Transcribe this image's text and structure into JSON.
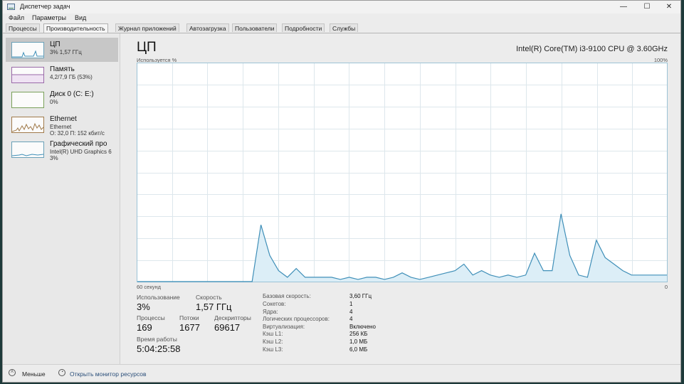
{
  "window": {
    "title": "Диспетчер задач",
    "minimize_glyph": "—",
    "maximize_glyph": "☐",
    "close_glyph": "✕"
  },
  "menu": [
    "Файл",
    "Параметры",
    "Вид"
  ],
  "tabs": [
    "Процессы",
    "Производительность",
    "Журнал приложений",
    "Автозагрузка",
    "Пользователи",
    "Подробности",
    "Службы"
  ],
  "active_tab": 1,
  "sidebar": {
    "items": [
      {
        "name": "ЦП",
        "sub": "3% 1,57 ГГц",
        "sub2": ""
      },
      {
        "name": "Память",
        "sub": "4,2/7,9 ГБ (53%)",
        "sub2": ""
      },
      {
        "name": "Диск 0 (C: E:)",
        "sub": "0%",
        "sub2": ""
      },
      {
        "name": "Ethernet",
        "sub": "Ethernet",
        "sub2": "О: 32,0 П: 152 кбит/с"
      },
      {
        "name": "Графический про",
        "sub": "Intel(R) UHD Graphics 6",
        "sub2": "3%"
      }
    ],
    "selected": 0
  },
  "main": {
    "title": "ЦП",
    "cpu_name": "Intel(R) Core(TM) i3-9100 CPU @ 3.60GHz",
    "graph_top_left": "Используется %",
    "graph_top_right": "100%",
    "graph_bottom_left": "60 секунд",
    "graph_bottom_right": "0"
  },
  "stats": {
    "usage_label": "Использование",
    "usage_value": "3%",
    "speed_label": "Скорость",
    "speed_value": "1,57 ГГц",
    "processes_label": "Процессы",
    "processes_value": "169",
    "threads_label": "Потоки",
    "threads_value": "1677",
    "handles_label": "Дескрипторы",
    "handles_value": "69617",
    "uptime_label": "Время работы",
    "uptime_value": "5:04:25:58"
  },
  "specs": [
    {
      "key": "Базовая скорость:",
      "value": "3,60 ГГц"
    },
    {
      "key": "Сокетов:",
      "value": "1"
    },
    {
      "key": "Ядра:",
      "value": "4"
    },
    {
      "key": "Логических процессоров:",
      "value": "4"
    },
    {
      "key": "Виртуализация:",
      "value": "Включено"
    },
    {
      "key": "Кэш L1:",
      "value": "256 КБ"
    },
    {
      "key": "Кэш L2:",
      "value": "1,0 МБ"
    },
    {
      "key": "Кэш L3:",
      "value": "6,0 МБ"
    }
  ],
  "footer": {
    "less_label": "Меньше",
    "monitor_label": "Открыть монитор ресурсов"
  },
  "colors": {
    "cpu_line": "#3f8fb8",
    "cpu_fill": "#dceef7",
    "grid": "#dde7ec"
  },
  "chart_data": {
    "type": "area",
    "x": [
      0,
      1,
      2,
      3,
      4,
      5,
      6,
      7,
      8,
      9,
      10,
      11,
      12,
      13,
      14,
      15,
      16,
      17,
      18,
      19,
      20,
      21,
      22,
      23,
      24,
      25,
      26,
      27,
      28,
      29,
      30,
      31,
      32,
      33,
      34,
      35,
      36,
      37,
      38,
      39,
      40,
      41,
      42,
      43,
      44,
      45,
      46,
      47,
      48,
      49,
      50,
      51,
      52,
      53,
      54,
      55,
      56,
      57,
      58,
      59,
      60
    ],
    "values": [
      0,
      0,
      0,
      0,
      0,
      0,
      0,
      0,
      0,
      0,
      0,
      0,
      0,
      0,
      26,
      12,
      5,
      2,
      6,
      2,
      2,
      2,
      2,
      1,
      2,
      1,
      2,
      2,
      1,
      2,
      4,
      2,
      1,
      2,
      3,
      4,
      5,
      8,
      3,
      5,
      3,
      2,
      3,
      2,
      3,
      13,
      5,
      5,
      31,
      12,
      3,
      2,
      19,
      11,
      8,
      5,
      3,
      3,
      3,
      3,
      3
    ],
    "xlim": [
      60,
      0
    ],
    "ylim": [
      0,
      100
    ],
    "ylabel": "Используется %",
    "grid": true
  }
}
